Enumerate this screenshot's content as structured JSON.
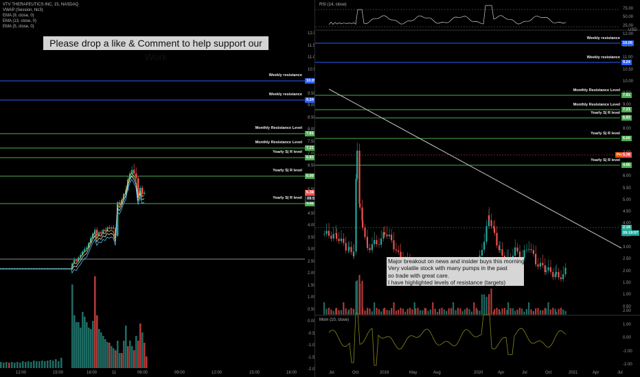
{
  "left_chart": {
    "legend": [
      "VTV THERAPEUTICS INC, 15, NASDAQ",
      "VWAP (Session, hlc3)",
      "EMA (9, close, 0)",
      "EMA (13, close, 0)",
      "EMA (5, close, 0)"
    ],
    "banner": "Please drop a like & Comment to help support our Work",
    "price_axis": [
      "12.00",
      "11.50",
      "11.00",
      "10.50",
      "10.00",
      "9.50",
      "9.00",
      "8.50",
      "8.00",
      "7.50",
      "7.00",
      "6.50",
      "6.00",
      "5.50",
      "5.00",
      "4.50",
      "4.00",
      "3.50",
      "3.00",
      "2.50",
      "2.00",
      "1.50",
      "1.00",
      "0.50",
      "0.00",
      "-0.50",
      "-1.00",
      "-1.50",
      "-2.00"
    ],
    "time_axis": [
      "12:00",
      "15:00",
      "18:00",
      "11",
      "06:00",
      "09:00",
      "12:00",
      "15:00",
      "18:00"
    ],
    "levels": [
      {
        "label": "Weekly resistance",
        "tag": "10.05",
        "color": "#2962ff"
      },
      {
        "label": "Weekly resistance",
        "tag": "9.24",
        "color": "#2962ff"
      },
      {
        "label": "Monthly Resistance Level",
        "tag": "7.81",
        "color": "#4caf50"
      },
      {
        "label": "Monthly Resistance Level",
        "tag": "7.21",
        "color": "#4caf50"
      },
      {
        "label": "Yearly  S| R level",
        "tag": "6.83",
        "color": "#4caf50"
      },
      {
        "label": "Yearly  S| R level",
        "tag": "6.00",
        "color": "#4caf50"
      },
      {
        "label": "Yearly  S| R level",
        "tag": "4.86",
        "color": "#4caf50"
      }
    ],
    "price_tags": [
      {
        "text": "5.38",
        "color": "#ef5350"
      },
      {
        "text": "09:58",
        "color": "#131722"
      }
    ]
  },
  "right_chart": {
    "rsi": {
      "title": "RSI (14, close)",
      "axis": [
        "75.00",
        "50.00",
        "25.00"
      ]
    },
    "currency": "USD",
    "price_axis": [
      "13.00",
      "12.50",
      "12.00",
      "11.50",
      "11.00",
      "10.50",
      "10.00",
      "9.50",
      "9.00",
      "8.50",
      "8.00",
      "7.50",
      "7.00",
      "6.50",
      "6.00",
      "5.50",
      "5.00",
      "4.50",
      "4.00",
      "3.50",
      "3.00",
      "2.50",
      "2.00",
      "1.50",
      "1.00",
      "0.50",
      "0.00",
      "-0.50",
      "-1.00",
      "-1.50"
    ],
    "time_axis": [
      "Jul",
      "Oct",
      "2019",
      "May",
      "Aug",
      "2020",
      "Apr",
      "Jul",
      "Oct",
      "2021",
      "Apr",
      "Jul"
    ],
    "levels": [
      {
        "label": "Weekly resistance",
        "tag": "10.05",
        "color": "#2962ff"
      },
      {
        "label": "Weekly resistance",
        "tag": "9.24",
        "color": "#2962ff"
      },
      {
        "label": "Monthly Resistance Level",
        "tag": "7.81",
        "color": "#4caf50"
      },
      {
        "label": "Monthly Resistance Level",
        "tag": "7.21",
        "color": "#4caf50"
      },
      {
        "label": "Yearly  S| R level",
        "tag": "6.83",
        "color": "#4caf50"
      },
      {
        "label": "Yearly  S| R level",
        "tag": "6.00",
        "color": "#4caf50"
      },
      {
        "label": "Yearly  S| R level",
        "tag": "4.86",
        "color": "#4caf50"
      }
    ],
    "prev_tag": {
      "label": "Pre",
      "value": "5.38"
    },
    "price_tags": [
      {
        "text": "2.19",
        "color": "#26a69a"
      },
      {
        "text": "09:19:57",
        "color": "#26a69a"
      }
    ],
    "annotation": [
      "Major breakout on news and insider buys this morning.",
      "Very volatile stock with many pumps in the past",
      "so trade with great care.",
      "I have highlighted levels of resistance (targets)"
    ],
    "momentum": {
      "title": "Mom (10, close)",
      "axis": [
        "2.00",
        "1.00",
        "0.00",
        "-1.00",
        "-2.00"
      ]
    }
  },
  "colors": {
    "up": "#26a69a",
    "down": "#ef5350",
    "vol_up": "#1e6b63",
    "vol_down": "#b03a38",
    "blue_level": "#2962ff",
    "green_level": "#4caf50",
    "trendline": "#c8c8c8",
    "rsi_line": "#d0d0d0",
    "mom_line": "#8c8a1e"
  }
}
